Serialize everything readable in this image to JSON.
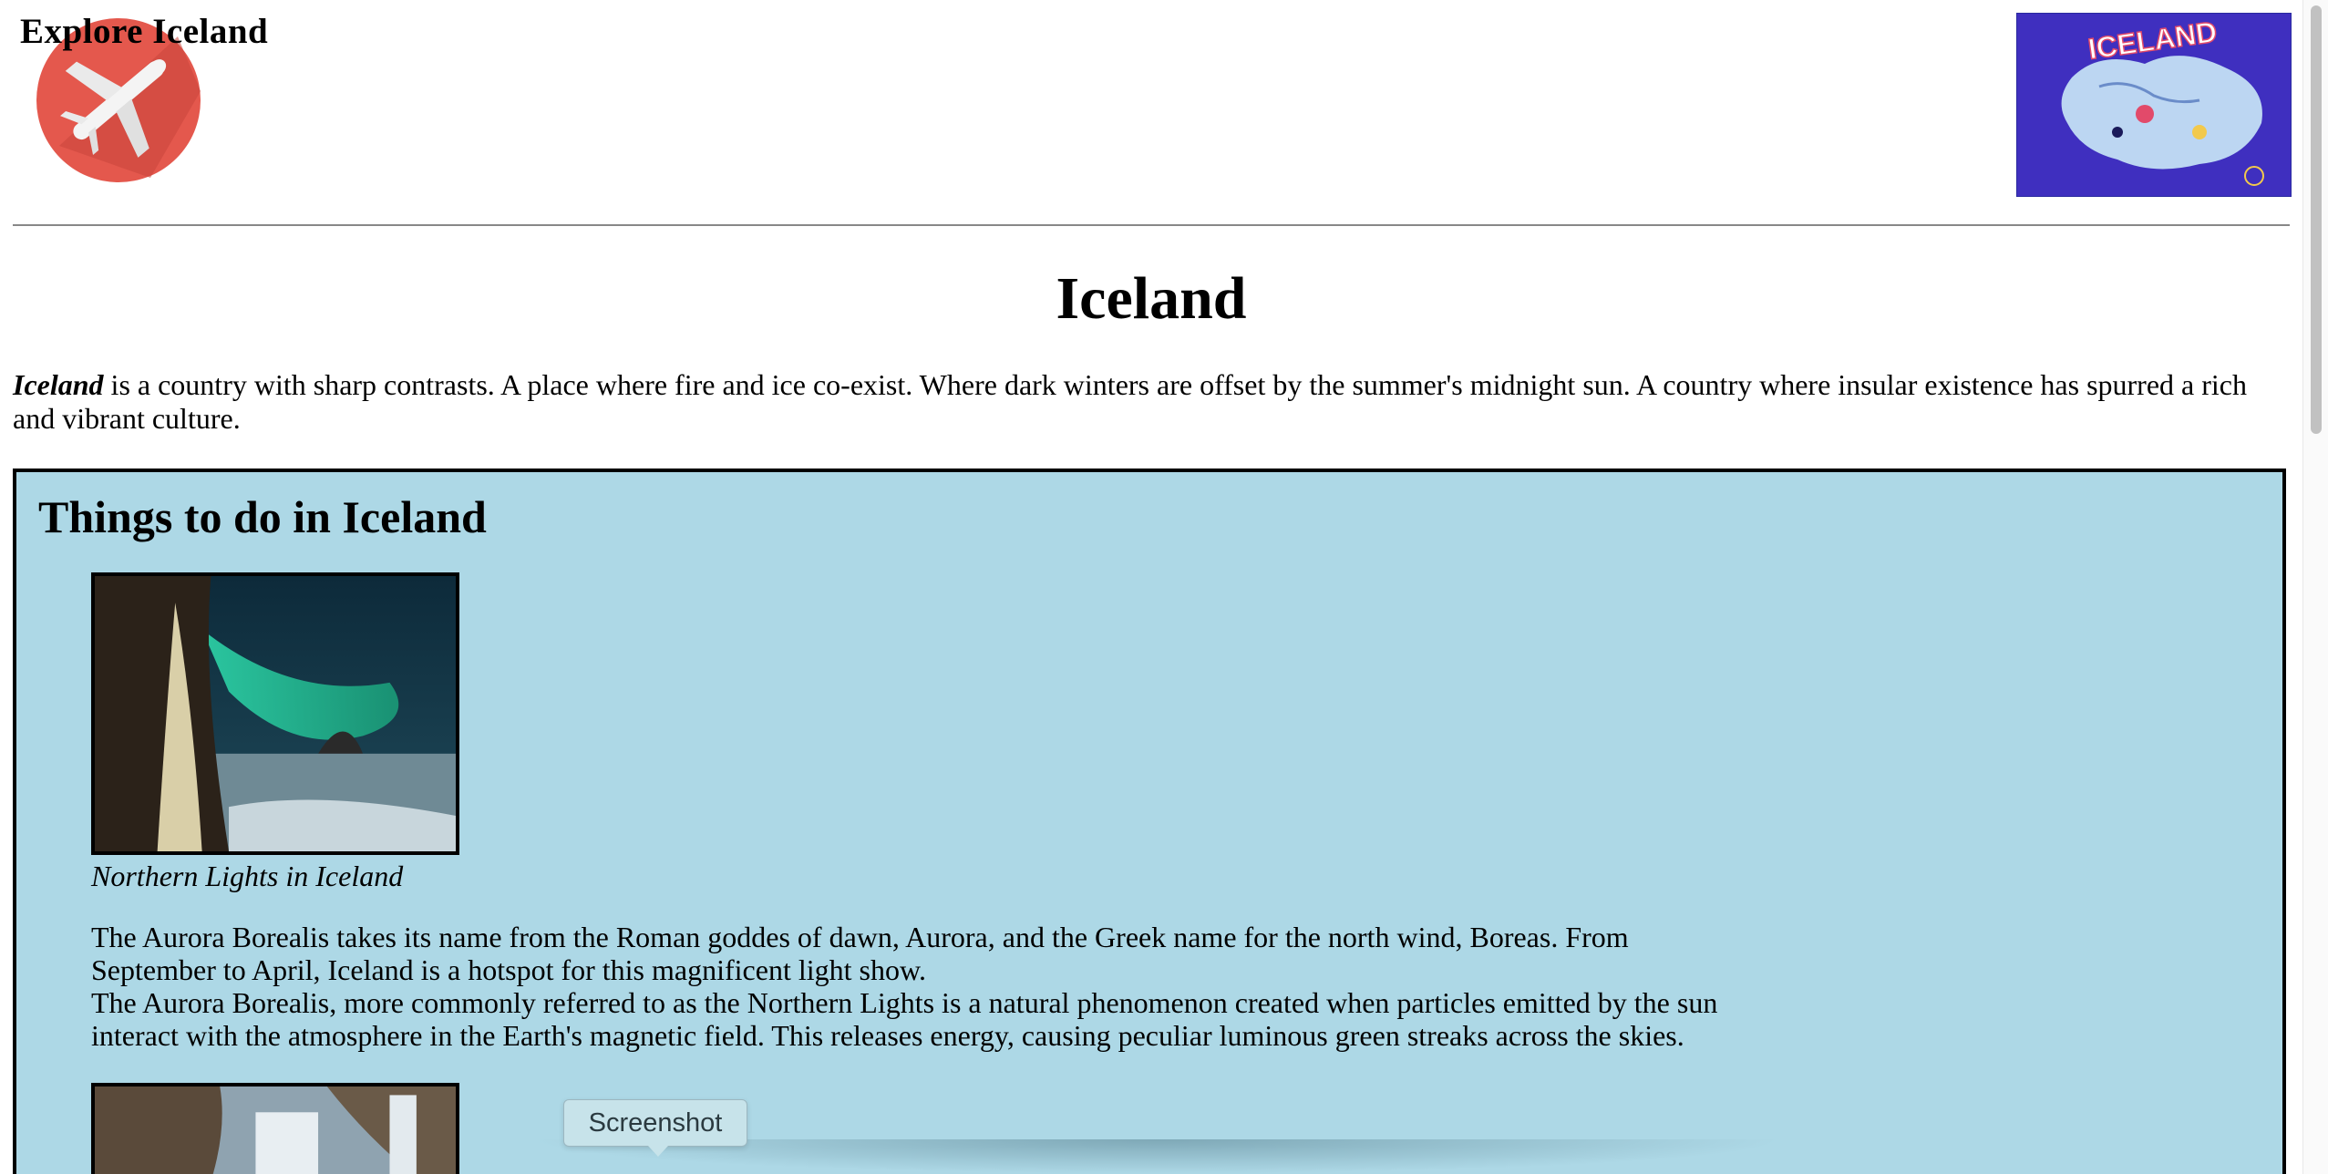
{
  "header": {
    "site_title": "Explore Iceland",
    "logo_icon": "airplane-icon",
    "map_image_label": "ICELAND"
  },
  "main": {
    "heading": "Iceland",
    "intro_emphasis": "Iceland",
    "intro_text": " is a country with sharp contrasts. A place where fire and ice co-exist. Where dark winters are offset by the summer's midnight sun. A country where insular existence has spurred a rich and vibrant culture."
  },
  "things_to_do": {
    "heading": "Things to do in Iceland",
    "items": [
      {
        "caption": "Northern Lights in Iceland",
        "paragraph_1": "The Aurora Borealis takes its name from the Roman goddes of dawn, Aurora, and the Greek name for the north wind, Boreas. From September to April, Iceland is a hotspot for this magnificent light show.",
        "paragraph_2": "The Aurora Borealis, more commonly referred to as the Northern Lights is a natural phenomenon created when particles emitted by the sun interact with the atmosphere in the Earth's magnetic field. This releases energy, causing peculiar luminous green streaks across the skies."
      }
    ]
  },
  "overlay": {
    "tooltip_label": "Screenshot"
  },
  "colors": {
    "box_background": "#add8e6",
    "logo_red": "#e4584d",
    "map_blue": "#3f2fbf"
  }
}
